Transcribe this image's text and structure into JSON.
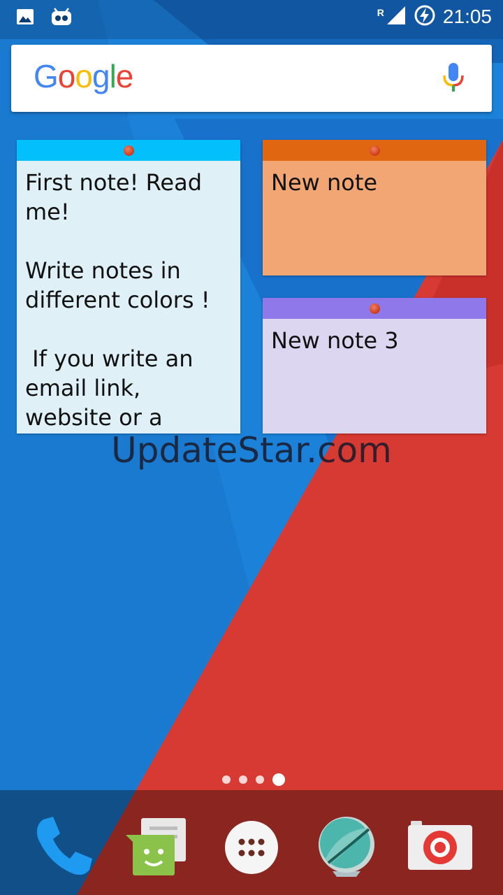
{
  "status_bar": {
    "time": "21:05",
    "network_indicator": "R",
    "left_icons": [
      "image-notification-icon",
      "cyanogen-notification-icon"
    ],
    "right_icons": [
      "signal-icon",
      "battery-charging-icon"
    ]
  },
  "search_widget": {
    "logo_letters": [
      "G",
      "o",
      "o",
      "g",
      "l",
      "e"
    ],
    "mic_icon": "mic-icon"
  },
  "notes": [
    {
      "text": "First note! Read me!\n\nWrite notes in different colors !\n\n If you write an email link, website or a number you",
      "bar_color": "#03bffc",
      "body_color": "#dff0f6"
    },
    {
      "text": "New note",
      "bar_color": "#e16611",
      "body_color": "#f2a674"
    },
    {
      "text": "New note 3",
      "bar_color": "#8e78ea",
      "body_color": "#dcd6f0"
    }
  ],
  "watermark": "UpdateStar.com",
  "page_indicator": {
    "count": 4,
    "active": 4
  },
  "dock": [
    {
      "icon": "phone-icon"
    },
    {
      "icon": "messaging-icon"
    },
    {
      "icon": "app-drawer-icon"
    },
    {
      "icon": "browser-icon"
    },
    {
      "icon": "camera-icon"
    }
  ]
}
